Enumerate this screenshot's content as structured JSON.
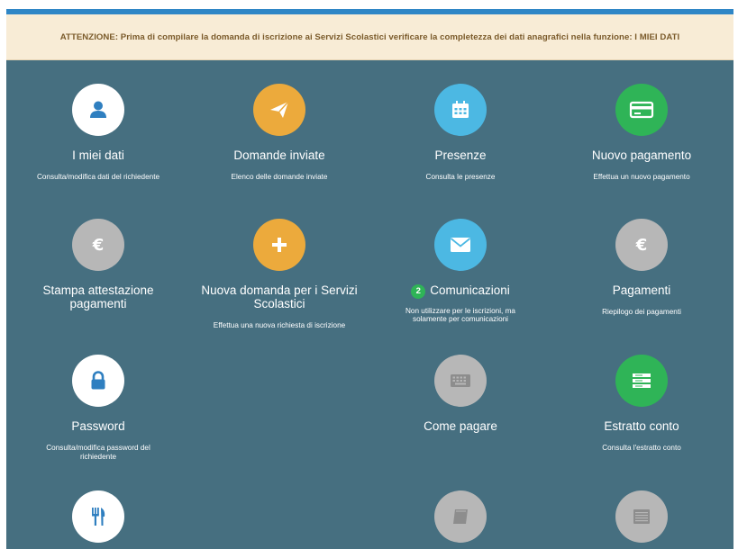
{
  "notice": {
    "text": "ATTENZIONE: Prima di compilare la domanda di iscrizione ai Servizi Scolastici verificare la completezza dei dati anagrafici nella funzione: I MIEI DATI"
  },
  "colors": {
    "header_bar": "#2f86c6",
    "notice_bg": "#f8ecd6",
    "page_bg": "#466f80",
    "icon_orange": "#ecaa3c",
    "icon_blue": "#4cb8e3",
    "icon_green": "#2fb457",
    "icon_gray": "#b7b7b7"
  },
  "tiles": [
    {
      "title": "I miei dati",
      "desc": "Consulta/modifica dati del richiedente",
      "icon": "user-icon"
    },
    {
      "title": "Domande inviate",
      "desc": "Elenco delle domande inviate",
      "icon": "paper-plane-icon"
    },
    {
      "title": "Presenze",
      "desc": "Consulta le presenze",
      "icon": "calendar-icon"
    },
    {
      "title": "Nuovo pagamento",
      "desc": "Effettua un nuovo pagamento",
      "icon": "credit-card-icon"
    },
    {
      "title": "Stampa attestazione pagamenti",
      "desc": "",
      "icon": "euro-icon"
    },
    {
      "title": "Nuova domanda per i Servizi Scolastici",
      "desc": "Effettua una nuova richiesta di iscrizione",
      "icon": "plus-icon"
    },
    {
      "title": "Comunicazioni",
      "badge": "2",
      "desc": "Non utilizzare per le iscrizioni, ma solamente per comunicazioni",
      "icon": "envelope-icon"
    },
    {
      "title": "Pagamenti",
      "desc": "Riepilogo dei pagamenti",
      "icon": "euro-icon"
    },
    {
      "title": "Password",
      "desc": "Consulta/modifica password del richiedente",
      "icon": "lock-icon"
    },
    {
      "title": "Come pagare",
      "desc": "",
      "icon": "keyboard-icon"
    },
    {
      "title": "Estratto conto",
      "desc": "Consulta l'estratto conto",
      "icon": "list-icon"
    },
    {
      "title": "",
      "desc": "",
      "icon": "cutlery-icon"
    },
    {
      "title": "",
      "desc": "",
      "icon": "book-icon"
    },
    {
      "title": "",
      "desc": "",
      "icon": "list-icon"
    }
  ]
}
